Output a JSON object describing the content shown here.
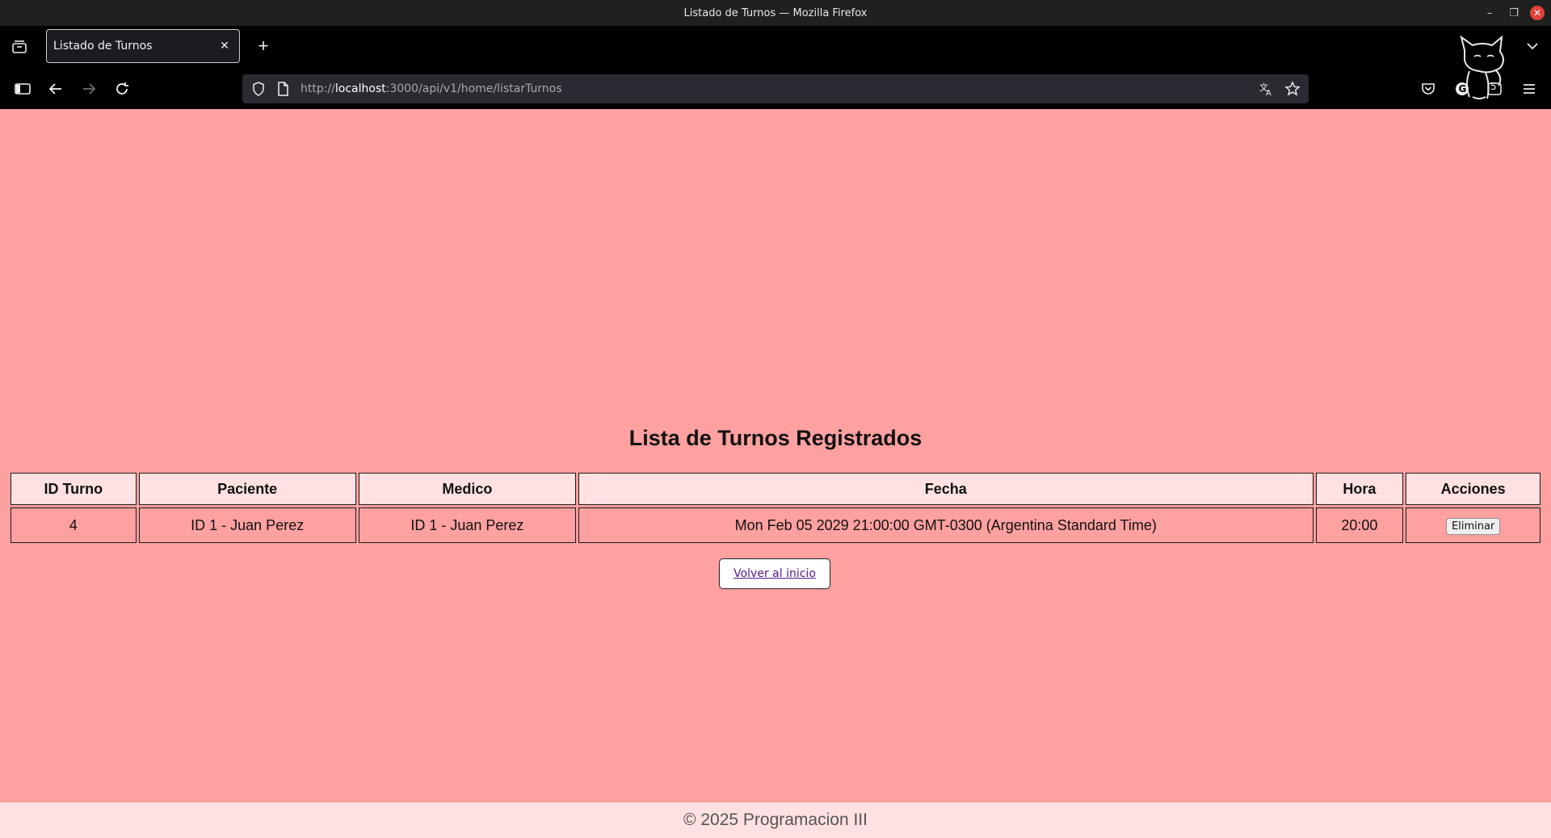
{
  "window": {
    "title": "Listado de Turnos — Mozilla Firefox"
  },
  "browser": {
    "tab_title": "Listado de Turnos",
    "url": {
      "scheme": "http://",
      "host": "localhost",
      "rest": ":3000/api/v1/home/listarTurnos"
    },
    "icons": [
      "tab-list-icon",
      "new-tab-icon",
      "sidebar-icon",
      "back-icon",
      "forward-icon",
      "reload-icon",
      "shield-icon",
      "page-icon",
      "translate-icon",
      "bookmark-star-icon",
      "pocket-icon",
      "extension-g-icon",
      "extension-badge-icon",
      "menu-icon",
      "cat-mascot-icon"
    ],
    "extension_badge": "5"
  },
  "page": {
    "title": "Lista de Turnos Registrados",
    "table": {
      "headers": [
        "ID Turno",
        "Paciente",
        "Medico",
        "Fecha",
        "Hora",
        "Acciones"
      ],
      "rows": [
        {
          "id": "4",
          "paciente": "ID 1 - Juan Perez",
          "medico": "ID 1 - Juan Perez",
          "fecha": "Mon Feb 05 2029 21:00:00 GMT-0300 (Argentina Standard Time)",
          "hora": "20:00",
          "action_label": "Eliminar"
        }
      ]
    },
    "back_link": "Volver al inicio",
    "footer": "© 2025 Programacion III"
  },
  "colors": {
    "page_bg": "#ffa1a0",
    "header_bg": "#ffe1e1",
    "footer_bg": "#ffe1e1",
    "browser_chrome": "#000000"
  }
}
